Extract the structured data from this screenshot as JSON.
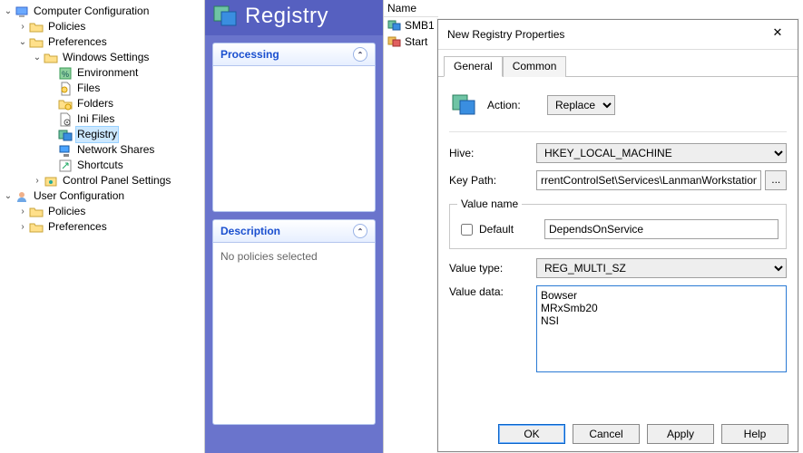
{
  "banner": {
    "title": "Registry"
  },
  "tree": {
    "computer_configuration": "Computer Configuration",
    "policies_cc": "Policies",
    "preferences_cc": "Preferences",
    "windows_settings": "Windows Settings",
    "environment": "Environment",
    "files": "Files",
    "folders": "Folders",
    "ini_files": "Ini Files",
    "registry": "Registry",
    "network_shares": "Network Shares",
    "shortcuts": "Shortcuts",
    "control_panel_settings": "Control Panel Settings",
    "user_configuration": "User Configuration",
    "policies_uc": "Policies",
    "preferences_uc": "Preferences"
  },
  "panels": {
    "processing": "Processing",
    "description": "Description",
    "description_body": "No policies selected"
  },
  "list": {
    "header": "Name",
    "items": [
      "SMB1",
      "Start"
    ]
  },
  "dialog": {
    "title": "New Registry Properties",
    "tab_general": "General",
    "tab_common": "Common",
    "action_label": "Action:",
    "action_value": "Replace",
    "hive_label": "Hive:",
    "hive_value": "HKEY_LOCAL_MACHINE",
    "keypath_label": "Key Path:",
    "keypath_value": "rrentControlSet\\Services\\LanmanWorkstation",
    "browse": "...",
    "fieldset_legend": "Value name",
    "default_label": "Default",
    "valuename_value": "DependsOnService",
    "valuetype_label": "Value type:",
    "valuetype_value": "REG_MULTI_SZ",
    "valuedata_label": "Value data:",
    "valuedata_value": "Bowser\nMRxSmb20\nNSI",
    "ok": "OK",
    "cancel": "Cancel",
    "apply": "Apply",
    "help": "Help"
  }
}
